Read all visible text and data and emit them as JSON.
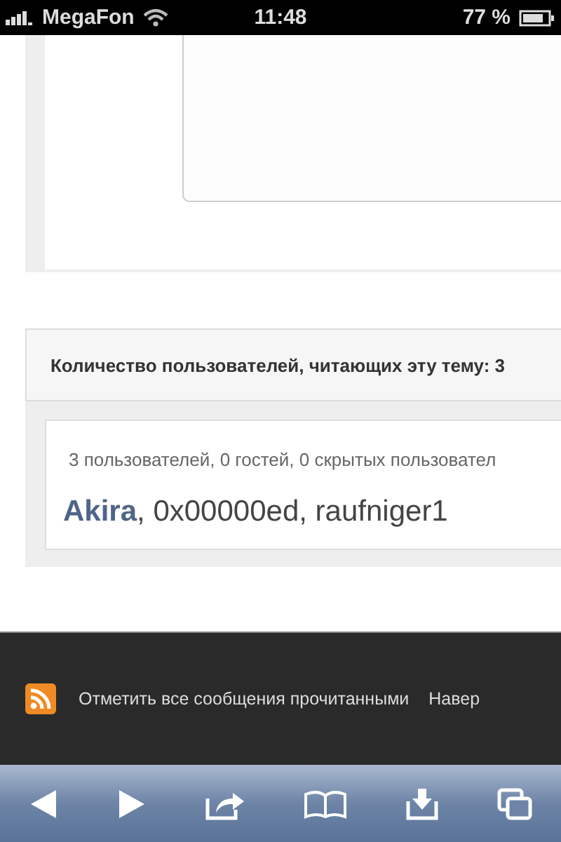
{
  "status_bar": {
    "carrier": "MegaFon",
    "time": "11:48",
    "battery": "77 %"
  },
  "viewers": {
    "title": "Количество пользователей, читающих эту тему: 3",
    "summary": "3 пользователей, 0 гостей, 0 скрытых пользовател",
    "users": "**Akira**, 0x00000ed, raufniger1"
  },
  "footer": {
    "links": [
      "Отметить все сообщения прочитанными",
      "Навер"
    ]
  },
  "toolbar": [
    {
      "kind": "back"
    },
    {
      "kind": "forward"
    },
    {
      "kind": "share"
    },
    {
      "kind": "bookmarks"
    },
    {
      "kind": "download"
    },
    {
      "kind": "tabs"
    }
  ]
}
